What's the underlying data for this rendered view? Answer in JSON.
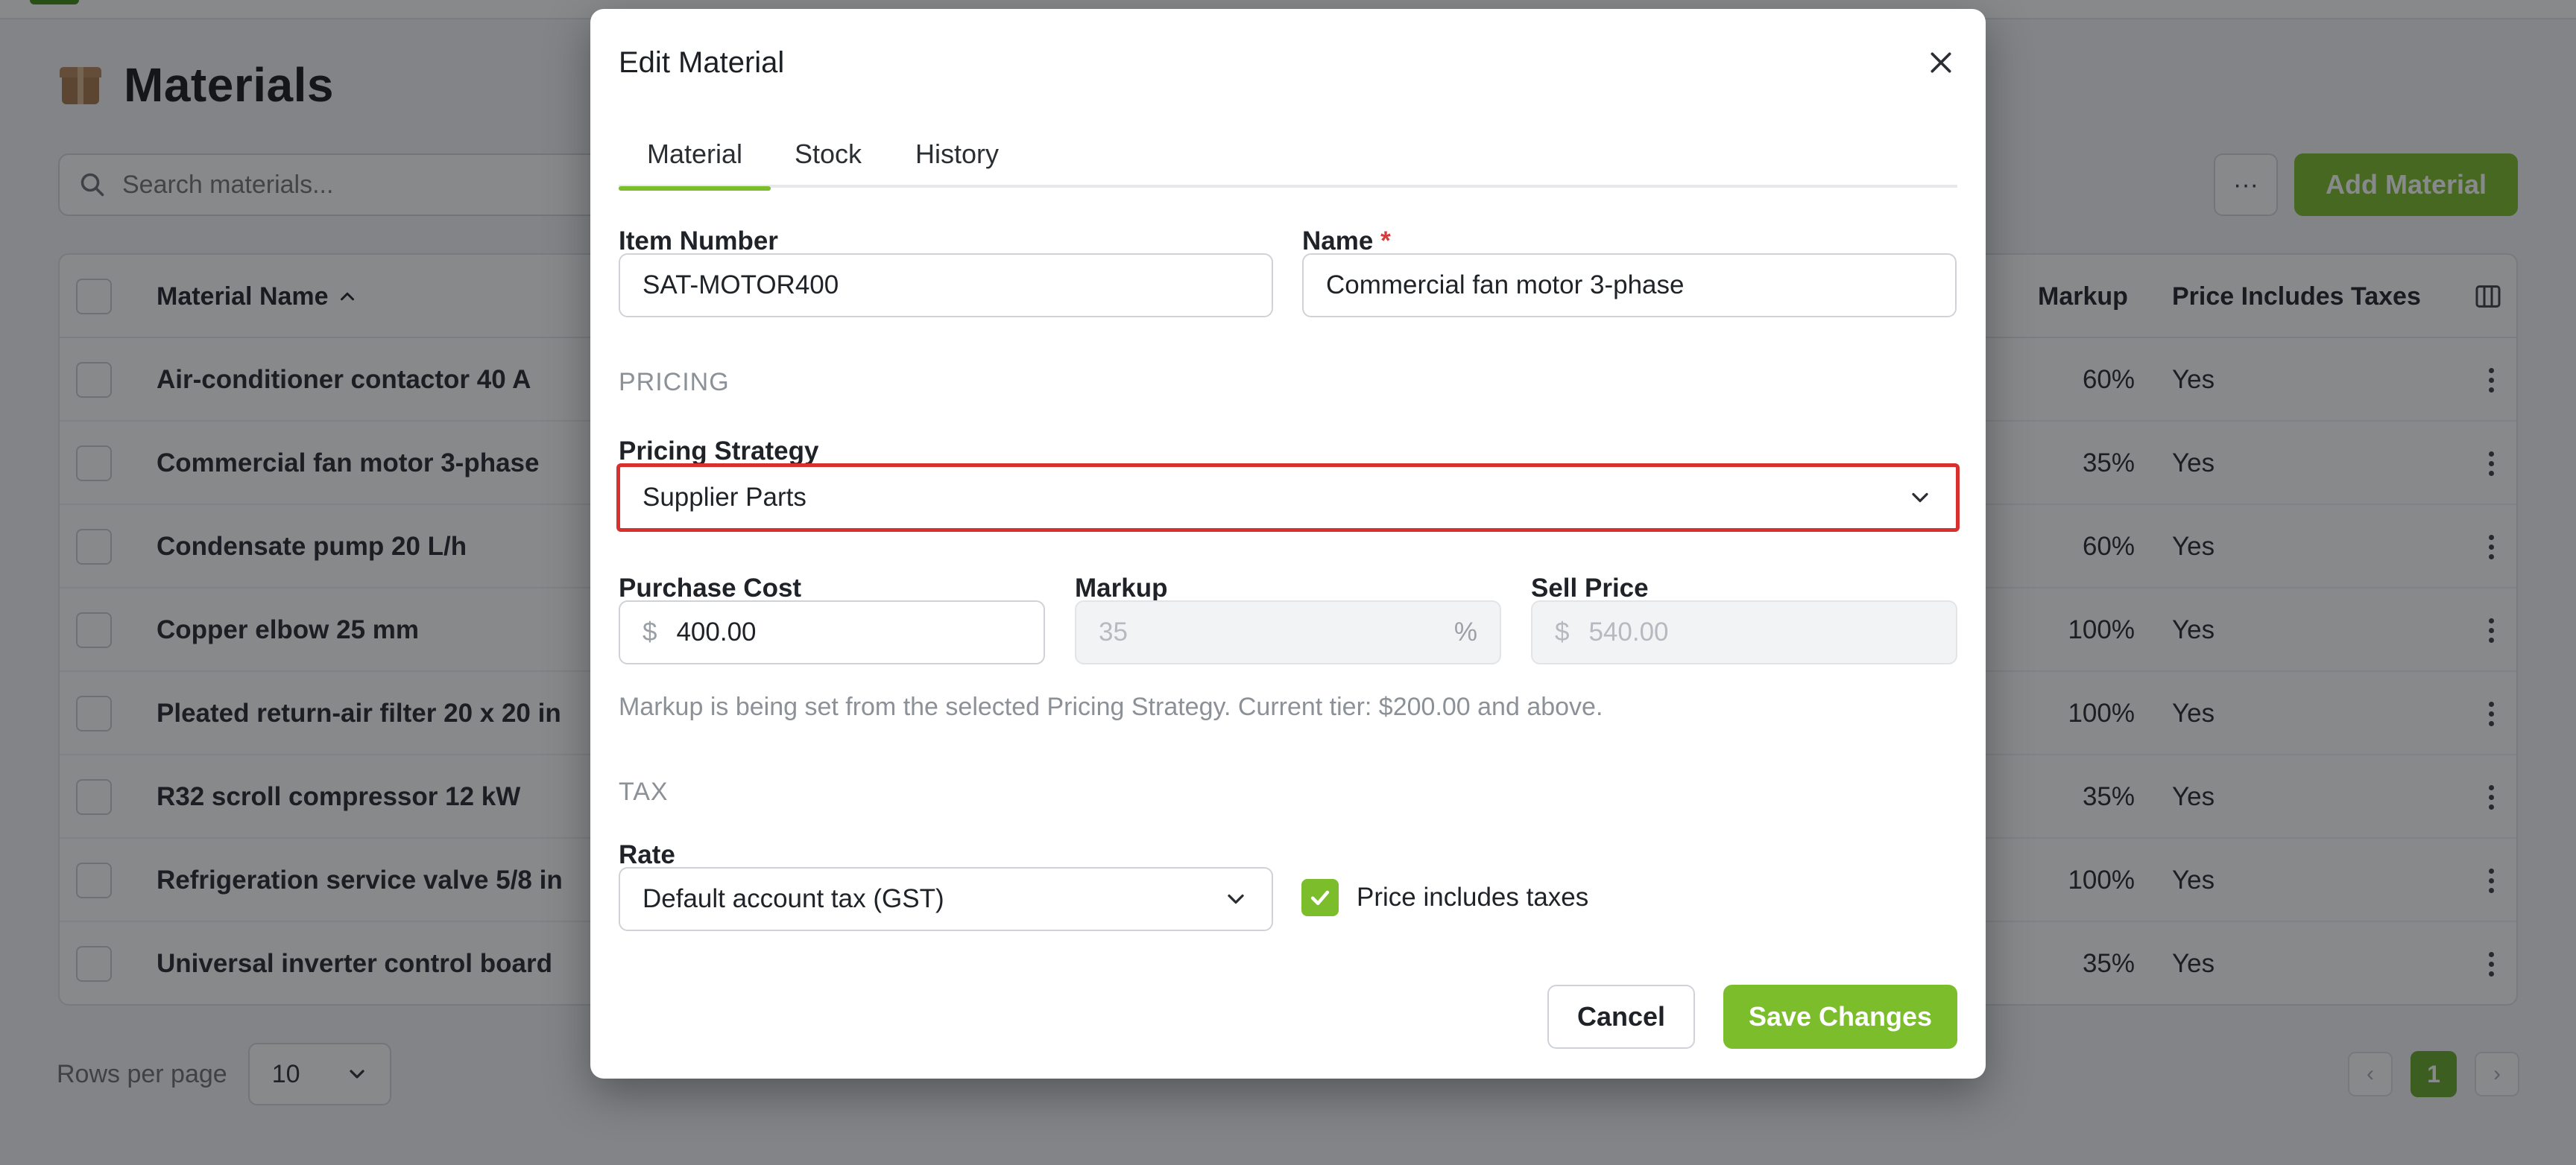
{
  "page": {
    "title": "Materials",
    "search_placeholder": "Search materials...",
    "more_label": "···",
    "add_button": "Add Material"
  },
  "table": {
    "columns": {
      "material_name": "Material Name",
      "markup": "Markup",
      "price_includes_taxes": "Price Includes Taxes"
    },
    "rows": [
      {
        "name": "Air-conditioner contactor 40 A",
        "markup": "60%",
        "taxes": "Yes"
      },
      {
        "name": "Commercial fan motor 3-phase",
        "markup": "35%",
        "taxes": "Yes"
      },
      {
        "name": "Condensate pump 20 L/h",
        "markup": "60%",
        "taxes": "Yes"
      },
      {
        "name": "Copper elbow 25 mm",
        "markup": "100%",
        "taxes": "Yes"
      },
      {
        "name": "Pleated return-air filter 20 x 20 in",
        "markup": "100%",
        "taxes": "Yes"
      },
      {
        "name": "R32 scroll compressor 12 kW",
        "markup": "35%",
        "taxes": "Yes"
      },
      {
        "name": "Refrigeration service valve 5/8 in",
        "markup": "100%",
        "taxes": "Yes"
      },
      {
        "name": "Universal inverter control board",
        "markup": "35%",
        "taxes": "Yes"
      }
    ]
  },
  "pagination": {
    "rows_per_page_label": "Rows per page",
    "rows_per_page_value": "10",
    "current_page": "1",
    "prev": "‹",
    "next": "›"
  },
  "modal": {
    "title": "Edit Material",
    "tabs": [
      "Material",
      "Stock",
      "History"
    ],
    "item_number_label": "Item Number",
    "item_number_value": "SAT-MOTOR400",
    "name_label": "Name",
    "name_required": "*",
    "name_value": "Commercial fan motor 3-phase",
    "pricing_section": "PRICING",
    "pricing_strategy_label": "Pricing Strategy",
    "pricing_strategy_value": "Supplier Parts",
    "purchase_cost_label": "Purchase Cost",
    "purchase_cost_prefix": "$",
    "purchase_cost_value": "400.00",
    "markup_label": "Markup",
    "markup_value": "35",
    "markup_suffix": "%",
    "sell_price_label": "Sell Price",
    "sell_price_prefix": "$",
    "sell_price_value": "540.00",
    "help_text": "Markup is being set from the selected Pricing Strategy. Current tier: $200.00 and above.",
    "tax_section": "TAX",
    "rate_label": "Rate",
    "rate_value": "Default account tax (GST)",
    "price_includes_taxes_label": "Price includes taxes",
    "price_includes_taxes_checked": true,
    "cancel": "Cancel",
    "save": "Save Changes"
  },
  "colors": {
    "accent": "#7bbd2b",
    "highlight": "#d8302e"
  },
  "icons": [
    "box-icon",
    "search-icon",
    "sort-up-icon",
    "columns-icon",
    "kebab-icon",
    "close-icon",
    "chevron-down-icon",
    "check-icon"
  ]
}
